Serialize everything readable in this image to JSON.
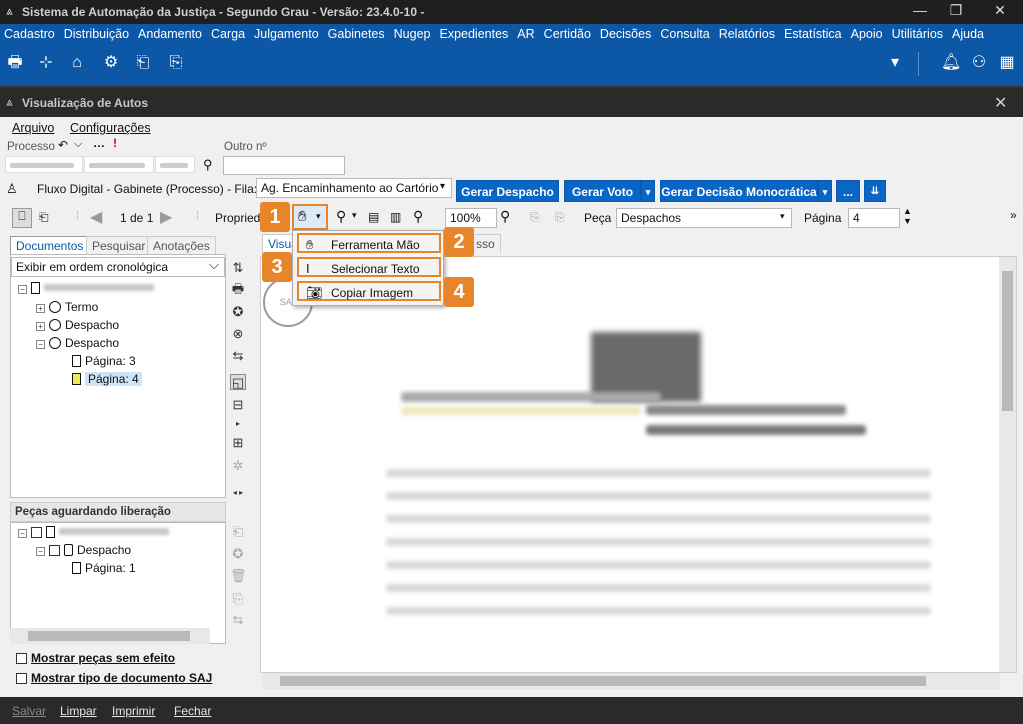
{
  "window": {
    "title": "Sistema de Automação da Justiça - Segundo Grau - Versão: 23.4.0-10 -"
  },
  "menu": [
    "Cadastro",
    "Distribuição",
    "Andamento",
    "Carga",
    "Julgamento",
    "Gabinetes",
    "Nugep",
    "Expedientes",
    "AR",
    "Certidão",
    "Decisões",
    "Consulta",
    "Relatórios",
    "Estatística",
    "Apoio",
    "Utilitários",
    "Ajuda"
  ],
  "subwindow": {
    "title": "Visualização de Autos"
  },
  "submenu": {
    "arquivo": "Arquivo",
    "config": "Configurações"
  },
  "fields": {
    "processo_label": "Processo",
    "outro_label": "Outro nº"
  },
  "fluxo": {
    "label": "Fluxo Digital - Gabinete (Processo) - Fila:",
    "fila_value": "Ag. Encaminhamento ao Cartório"
  },
  "buttons": {
    "gerar_despacho": "Gerar Despacho",
    "gerar_voto": "Gerar Voto",
    "gerar_decisao": "Gerar Decisão Monocrática",
    "more": "..."
  },
  "viewer_toolbar": {
    "pages": "1 de 1",
    "propriedades": "Propried",
    "zoom": "100%",
    "peca_label": "Peça",
    "peca_value": "Despachos",
    "pagina_label": "Página",
    "pagina_value": "4"
  },
  "left_tabs": [
    "Documentos",
    "Pesquisar",
    "Anotações"
  ],
  "order_select": "Exibir em ordem cronológica",
  "tree": {
    "termo": "Termo",
    "despacho1": "Despacho",
    "despacho2": "Despacho",
    "pag3": "Página: 3",
    "pag4": "Página: 4"
  },
  "pending": {
    "title": "Peças aguardando liberação",
    "despacho": "Despacho",
    "pag1": "Página: 1"
  },
  "checks": {
    "sem_efeito": "Mostrar peças sem efeito",
    "tipo_saj": "Mostrar tipo de documento SAJ"
  },
  "viewer_tabs": {
    "tab1": "Visua",
    "tab2": "sso"
  },
  "popup": {
    "items": [
      "Ferramenta Mão",
      "Selecionar Texto",
      "Copiar Imagem"
    ]
  },
  "badges": [
    "1",
    "2",
    "3",
    "4"
  ],
  "bottom": {
    "salvar": "Salvar",
    "limpar": "Limpar",
    "imprimir": "Imprimir",
    "fechar": "Fechar"
  },
  "colors": {
    "accent": "#0d58a6",
    "button": "#0a66c6",
    "badge": "#e8852a"
  }
}
